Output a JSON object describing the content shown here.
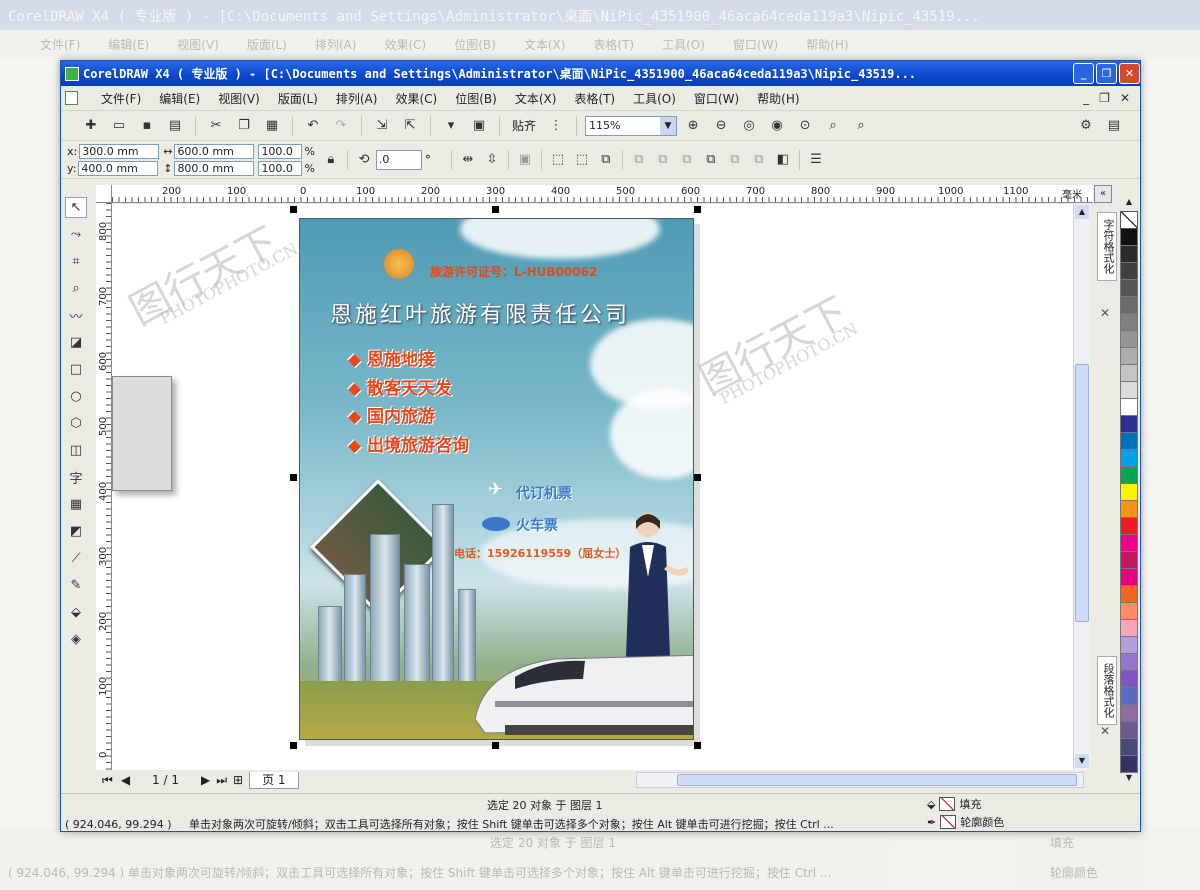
{
  "bg": {
    "title": "CorelDRAW X4 ( 专业版 ) - [C:\\Documents and Settings\\Administrator\\桌面\\NiPic_4351900_46aca64ceda119a3\\Nipic_43519...",
    "menu": [
      "文件(F)",
      "编辑(E)",
      "视图(V)",
      "版面(L)",
      "排列(A)",
      "效果(C)",
      "位图(B)",
      "文本(X)",
      "表格(T)",
      "工具(O)",
      "窗口(W)",
      "帮助(H)"
    ],
    "status_line1": "选定 20 对象 于 图层 1",
    "status_line2": "( 924.046, 99.294 )     单击对象两次可旋转/倾斜；双击工具可选择所有对象；按住 Shift 键单击可选择多个对象；按住 Alt 键单击可进行挖掘；按住 Ctrl ...",
    "fill": "填充",
    "outline": "轮廓颜色"
  },
  "window": {
    "title": "CorelDRAW X4 ( 专业版 ) - [C:\\Documents and Settings\\Administrator\\桌面\\NiPic_4351900_46aca64ceda119a3\\Nipic_43519...",
    "min": "_",
    "max": "❐",
    "close": "✕"
  },
  "menu": {
    "items": [
      "文件(F)",
      "编辑(E)",
      "视图(V)",
      "版面(L)",
      "排列(A)",
      "效果(C)",
      "位图(B)",
      "文本(X)",
      "表格(T)",
      "工具(O)",
      "窗口(W)",
      "帮助(H)"
    ],
    "doc_min": "_",
    "doc_max": "❐",
    "doc_close": "✕"
  },
  "toolbar": {
    "zoom": "115%",
    "snap": "贴齐"
  },
  "propbar": {
    "x_label": "x:",
    "x": "300.0 mm",
    "y_label": "y:",
    "y": "400.0 mm",
    "w": "600.0 mm",
    "h": "800.0 mm",
    "sx": "100.0",
    "sy": "100.0",
    "pct": "%",
    "rotate": ".0",
    "deg": "°"
  },
  "ruler": {
    "unit": "毫米",
    "top_ticks": [
      "200",
      "100",
      "0",
      "100",
      "200",
      "300",
      "400",
      "500",
      "600",
      "700",
      "800",
      "900",
      "1000",
      "1100"
    ],
    "left_ticks": [
      "800",
      "700",
      "600",
      "500",
      "400",
      "300",
      "200",
      "100",
      "0"
    ]
  },
  "pagebar": {
    "counter": "1 / 1",
    "tab": "页 1"
  },
  "docker": {
    "tab1": "字符格式化",
    "tab2": "段落格式化"
  },
  "palette": [
    "#111111",
    "#2b2b2b",
    "#3f3f3f",
    "#555555",
    "#6a6a6a",
    "#808080",
    "#969696",
    "#adadad",
    "#c4c4c4",
    "#dcdcdc",
    "#ffffff",
    "#2e3192",
    "#0072bc",
    "#00a0e9",
    "#00a651",
    "#fff200",
    "#f7941d",
    "#ed1c24",
    "#ec008c",
    "#c2185b",
    "#e6007e",
    "#f26522",
    "#ff8c69",
    "#f7a8b8",
    "#b39ddb",
    "#9575cd",
    "#7e57c2",
    "#5c6bc0",
    "#8d6e9e",
    "#6a5a8e",
    "#4a4a7a",
    "#333366"
  ],
  "poster": {
    "license": "旅游许可证号：L-HUB00062",
    "company": "恩施红叶旅游有限责任公司",
    "services": [
      "恩施地接",
      "散客天天发",
      "国内旅游",
      "出境旅游咨询"
    ],
    "ticket1": "代订机票",
    "ticket2": "火车票",
    "phone": "联系电话：15926119559（屈女士）"
  },
  "watermark": {
    "cn": "图行天下",
    "en": "PHOTOPHOTO.CN"
  },
  "status": {
    "line1": "选定 20 对象 于 图层 1",
    "coords": "( 924.046, 99.294 )",
    "hint": "单击对象两次可旋转/倾斜；双击工具可选择所有对象；按住 Shift 键单击可选择多个对象；按住 Alt 键单击可进行挖掘；按住 Ctrl ...",
    "fill": "填充",
    "outline": "轮廓颜色"
  }
}
